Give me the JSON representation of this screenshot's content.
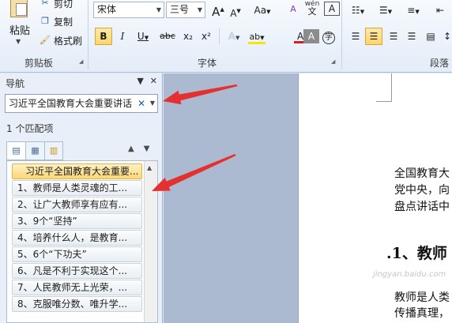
{
  "ribbon": {
    "clipboard": {
      "paste_label": "粘贴",
      "cut_label": "剪切",
      "copy_label": "复制",
      "format_painter_label": "格式刷",
      "group_label": "剪贴板"
    },
    "font": {
      "font_name": "宋体",
      "font_size": "三号",
      "grow_label": "A",
      "shrink_label": "A",
      "change_case_label": "Aa",
      "clear_format_label": "A",
      "pinyin_label": "wén",
      "border_char_label": "A",
      "bold_label": "B",
      "italic_label": "I",
      "underline_label": "U",
      "strike_label": "abc",
      "subscript_label": "x₂",
      "superscript_label": "x²",
      "text_effect_label": "A",
      "highlight_label": "ab",
      "font_color_label": "A",
      "char_shading_label": "A",
      "enclose_label": "字",
      "group_label": "字体",
      "highlight_color": "#f7e600",
      "font_color": "#e01b1b"
    },
    "paragraph": {
      "group_label": "段落"
    }
  },
  "nav": {
    "title": "导航",
    "search_value": "习近平全国教育大会重要讲话",
    "match_count": "1 个匹配项",
    "results": [
      "习近平全国教育大会重要...",
      "1、教师是人类灵魂的工...",
      "2、让广大教师享有应有...",
      "3、9个“坚持”",
      "4、培养什么人，是教育...",
      "5、6个“下功夫”",
      "6、凡是不利于实现这个...",
      "7、人民教师无上光荣，...",
      "8、克服唯分数、唯升学..."
    ]
  },
  "document": {
    "line1": "全国教育大",
    "line2": "党中央，向",
    "line3": "盘点讲话中",
    "heading": ".1、教师",
    "line4": "教师是人类",
    "line5": "传播真理，"
  },
  "annotations": {
    "arrow_color": "#e53030"
  },
  "watermark": "jingyan.baidu.com"
}
